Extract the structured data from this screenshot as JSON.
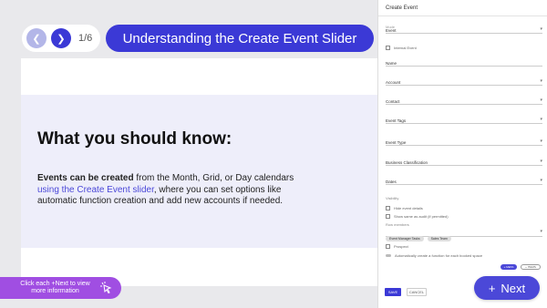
{
  "nav": {
    "page_counter": "1/6",
    "title": "Understanding the Create Event Slider"
  },
  "card": {
    "heading": "What you should know:",
    "body_bold": "Events can be created",
    "body_part1": " from the Month, Grid, or Day calendars ",
    "body_link": "using the Create Event slider",
    "body_part2": ", where you can set options like automatic function creation and add new accounts if needed."
  },
  "hint": {
    "text": "Click each +Next to view more information"
  },
  "panel": {
    "title": "Create Event",
    "mode_label": "Mode",
    "mode_value": "Event",
    "internal_event": "Internal Event",
    "fields": [
      "Name",
      "Account",
      "Contact",
      "Event Tags",
      "Event Type",
      "Business Classification",
      "Dates"
    ],
    "visibility_label": "Visibility",
    "hide_event_details": "Hide event details",
    "show_same_team": "Show same as audit (if permitted)",
    "team_label": "Row members",
    "chips": [
      "Event Manager Tasks",
      "Sales Team"
    ],
    "prospect": "Prospect",
    "auto_create": "Automatically create a function for each booked space",
    "mini_pills": [
      "+ META",
      "+ ITEMS"
    ],
    "save": "SAVE",
    "cancel": "CANCEL"
  },
  "next_button": {
    "label": "Next",
    "icon": "plus-icon"
  },
  "colors": {
    "accent": "#3b39d6",
    "hint_purple": "#a04ee2",
    "band": "#eeeefa"
  }
}
